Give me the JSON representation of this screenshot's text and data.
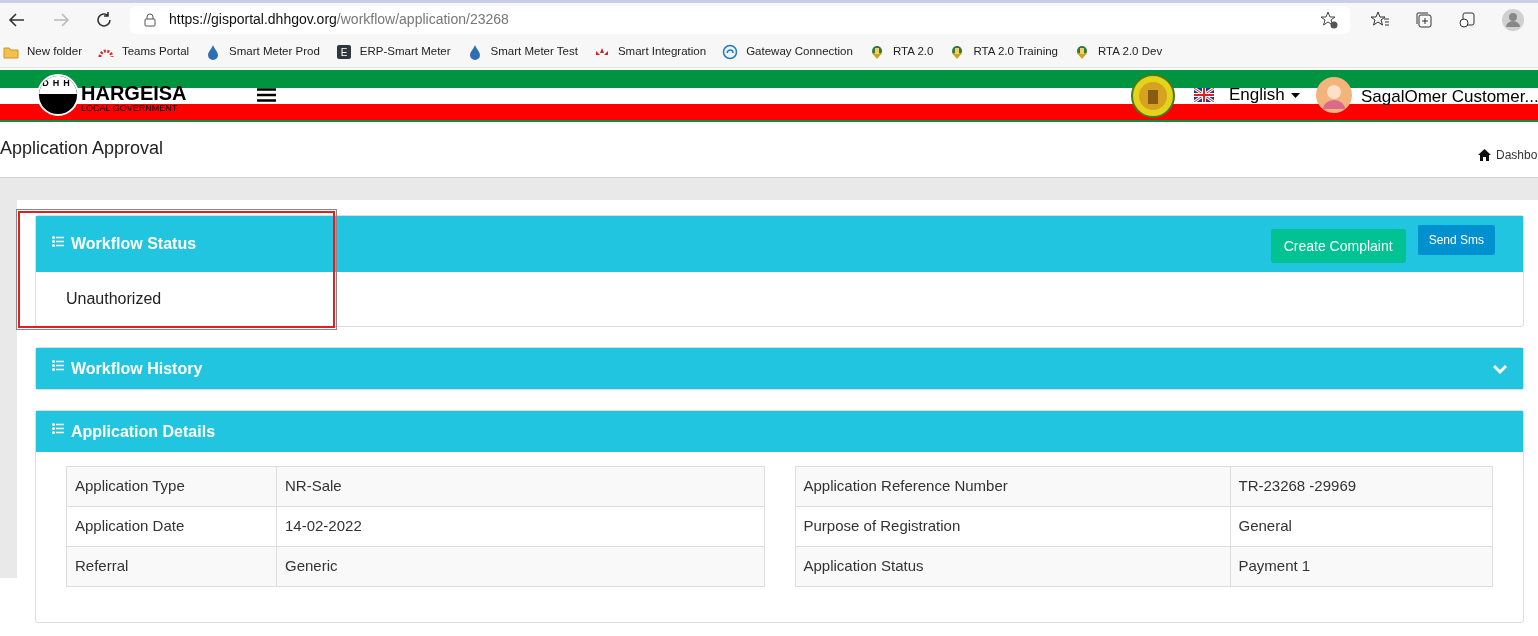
{
  "browser": {
    "url_host": "https://gisportal.dhhgov.org",
    "url_path": "/workflow/application/23268"
  },
  "bookmarks": [
    {
      "kind": "folder",
      "label": "New folder"
    },
    {
      "kind": "arc",
      "label": "Teams Portal"
    },
    {
      "kind": "drop",
      "label": "Smart Meter Prod"
    },
    {
      "kind": "letter",
      "letter": "E",
      "label": "ERP-Smart Meter"
    },
    {
      "kind": "drop",
      "label": "Smart Meter Test"
    },
    {
      "kind": "lotus",
      "label": "Smart Integration"
    },
    {
      "kind": "swirl",
      "label": "Gateway Connection"
    },
    {
      "kind": "emblem",
      "label": "RTA 2.0"
    },
    {
      "kind": "emblem",
      "label": "RTA 2.0 Training"
    },
    {
      "kind": "emblem",
      "label": "RTA 2.0 Dev"
    }
  ],
  "header": {
    "logo_letters": "DHH",
    "logo_title": "HARGEISA",
    "logo_subtitle": "LOCAL GOVERNMENT",
    "language": "English",
    "user": "SagalOmer Customer..."
  },
  "page": {
    "title": "Application Approval",
    "breadcrumb": "Dashbo"
  },
  "workflow_status": {
    "title": "Workflow Status",
    "buttons": [
      "Create Complaint",
      "Send Sms"
    ],
    "value": "Unauthorized"
  },
  "workflow_history": {
    "title": "Workflow History",
    "expanded": false
  },
  "application_details": {
    "title": "Application Details",
    "left": [
      [
        "Application Type",
        "NR-Sale"
      ],
      [
        "Application Date",
        "14-02-2022"
      ],
      [
        "Referral",
        "Generic"
      ]
    ],
    "right": [
      [
        "Application Reference Number",
        "TR-23268 -29969"
      ],
      [
        "Purpose of Registration",
        "General"
      ],
      [
        "Application Status",
        "Payment 1"
      ]
    ]
  }
}
